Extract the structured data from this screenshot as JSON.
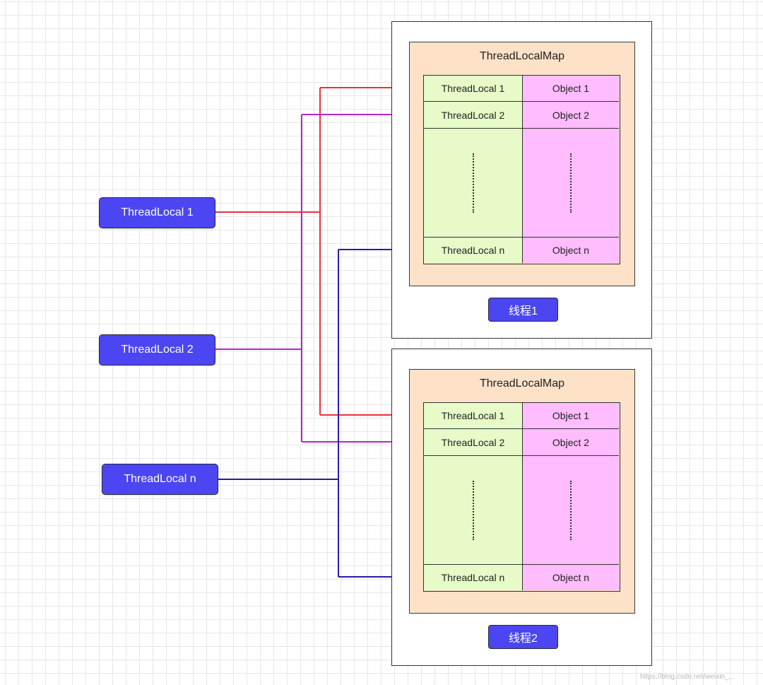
{
  "sources": [
    {
      "label": "ThreadLocal 1"
    },
    {
      "label": "ThreadLocal 2"
    },
    {
      "label": "ThreadLocal n"
    }
  ],
  "threads": [
    {
      "label": "线程1",
      "map_title": "ThreadLocalMap",
      "rows": [
        {
          "key": "ThreadLocal 1",
          "value": "Object 1"
        },
        {
          "key": "ThreadLocal 2",
          "value": "Object 2"
        },
        {
          "key": "ThreadLocal n",
          "value": "Object n"
        }
      ]
    },
    {
      "label": "线程2",
      "map_title": "ThreadLocalMap",
      "rows": [
        {
          "key": "ThreadLocal 1",
          "value": "Object 1"
        },
        {
          "key": "ThreadLocal 2",
          "value": "Object 2"
        },
        {
          "key": "ThreadLocal n",
          "value": "Object n"
        }
      ]
    }
  ],
  "colors": {
    "node_fill": "#4b45f2",
    "map_fill": "#fde2c8",
    "key_fill": "#e6fbc8",
    "value_fill": "#ffbcfe",
    "edge_threadlocal_1": "#e8323c",
    "edge_threadlocal_2": "#b526c8",
    "edge_threadlocal_n": "#2a1aa8"
  },
  "watermark": "https://blog.csdn.net/weixin_..."
}
